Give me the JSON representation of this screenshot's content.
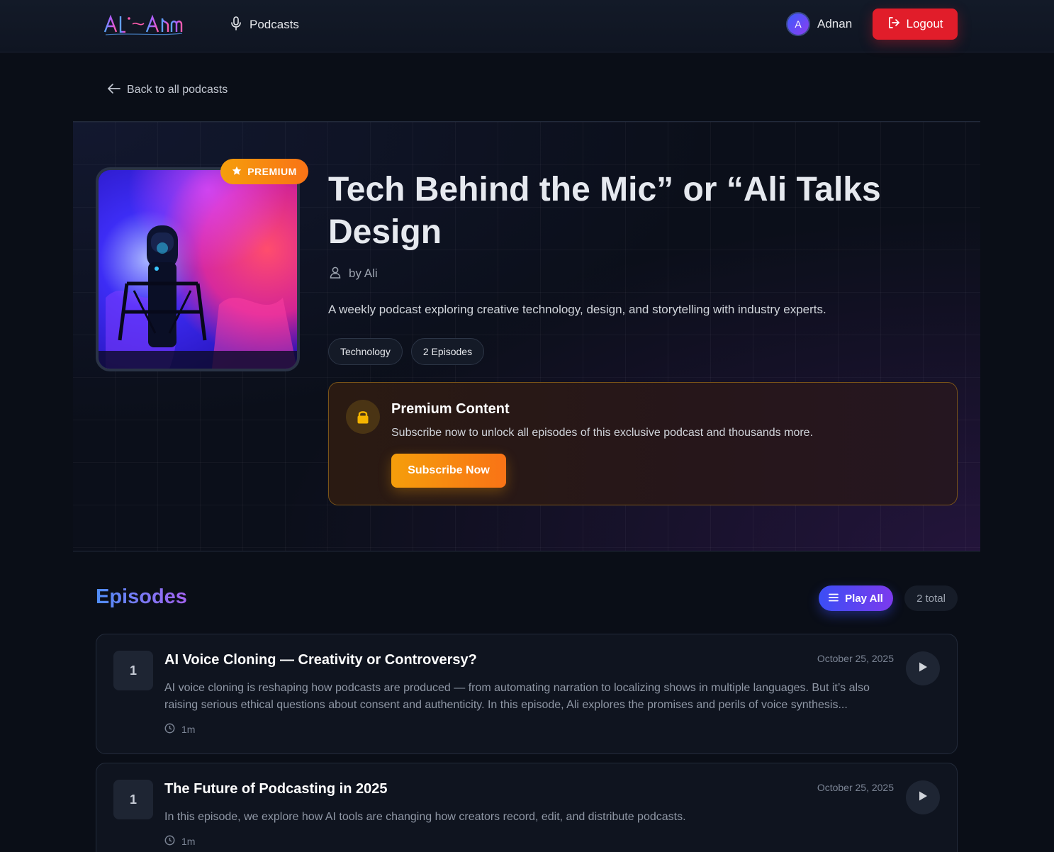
{
  "header": {
    "logo_text": "Al-Alfa",
    "nav_podcasts": "Podcasts",
    "user_initial": "A",
    "user_name": "Adnan",
    "logout_label": "Logout"
  },
  "back_link": "Back to all podcasts",
  "podcast": {
    "premium_badge": "PREMIUM",
    "title": "Tech Behind the Mic” or “Ali Talks Design",
    "author": "by Ali",
    "description": "A weekly podcast exploring creative technology, design, and storytelling with industry experts.",
    "tags": [
      "Technology",
      "2 Episodes"
    ]
  },
  "premium_box": {
    "title": "Premium Content",
    "text": "Subscribe now to unlock all episodes of this exclusive podcast and thousands more.",
    "button": "Subscribe Now"
  },
  "episodes_section": {
    "heading": "Episodes",
    "play_all": "Play All",
    "total": "2 total"
  },
  "episodes": [
    {
      "number": "1",
      "title": "AI Voice Cloning — Creativity or Controversy?",
      "date": "October 25, 2025",
      "description": "AI voice cloning is reshaping how podcasts are produced — from automating narration to localizing shows in multiple languages. But it’s also raising serious ethical questions about consent and authenticity. In this episode, Ali explores the promises and perils of voice synthesis...",
      "duration": "1m"
    },
    {
      "number": "1",
      "title": "The Future of Podcasting in 2025",
      "date": "October 25, 2025",
      "description": "In this episode, we explore how AI tools are changing how creators record, edit, and distribute podcasts.",
      "duration": "1m"
    }
  ],
  "colors": {
    "background": "#0a0e17",
    "logout": "#e11d2a",
    "premium_orange": "#f59e0b",
    "accent_blue": "#3b4ef5",
    "accent_purple": "#7c3aed"
  },
  "icons": [
    "microphone-icon",
    "logout-icon",
    "arrow-left-icon",
    "star-icon",
    "user-icon",
    "lock-icon",
    "list-icon",
    "clock-icon",
    "play-icon"
  ]
}
